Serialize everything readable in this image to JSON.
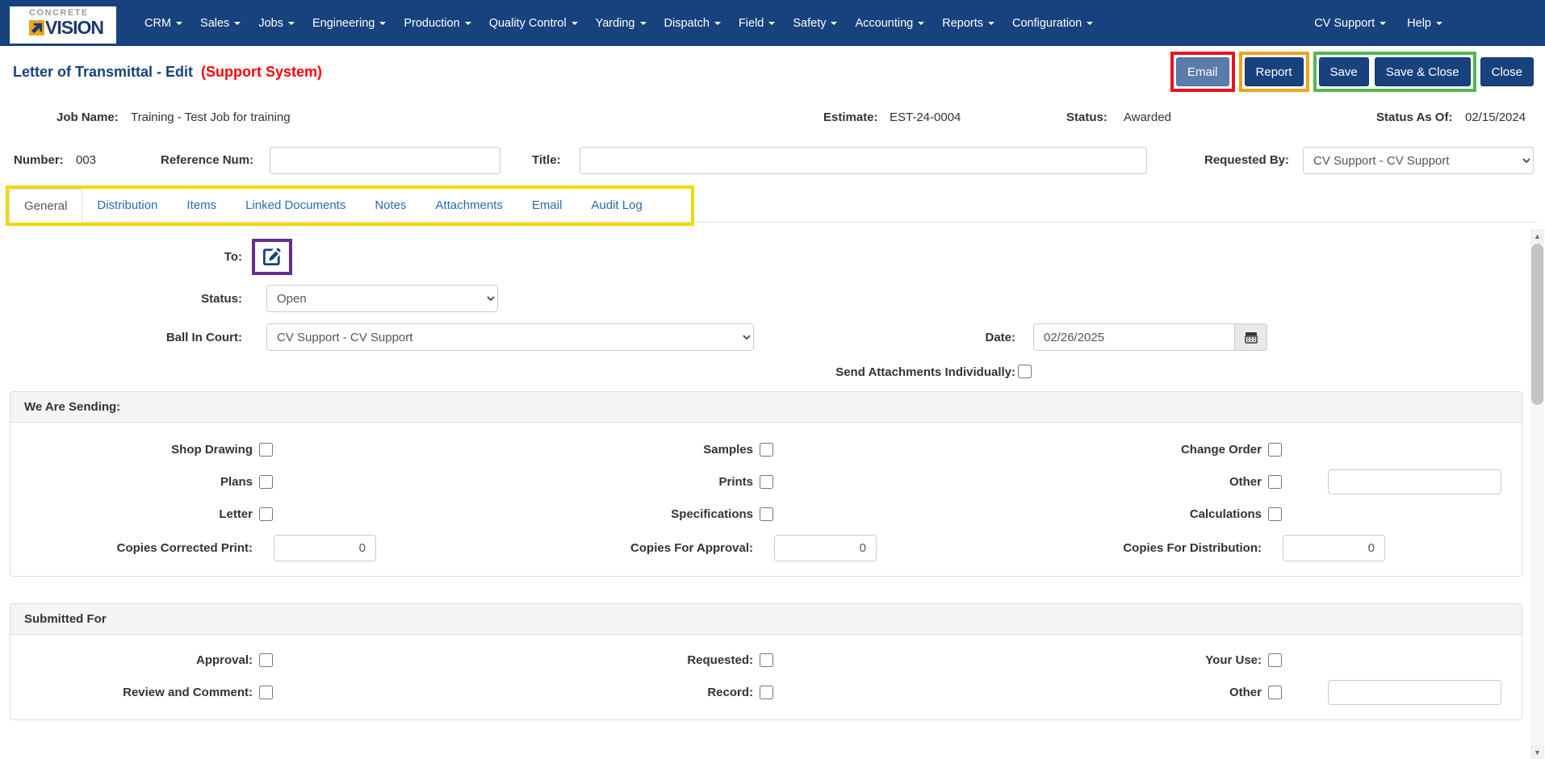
{
  "colors": {
    "navy": "#17427d",
    "title_red": "#ff0000",
    "annotation_red": "#e8151e",
    "annotation_orange": "#f0a31c",
    "annotation_green": "#53b94e",
    "annotation_yellow": "#f2d900",
    "annotation_purple": "#662d91",
    "tab_link_blue": "#2a6cab",
    "email_button_blue": "#5b7ca9"
  },
  "nav": {
    "logo_top": "CONCRETE",
    "logo_bottom": "VISION",
    "items": [
      "CRM",
      "Sales",
      "Jobs",
      "Engineering",
      "Production",
      "Quality Control",
      "Yarding",
      "Dispatch",
      "Field",
      "Safety",
      "Accounting",
      "Reports",
      "Configuration"
    ],
    "user_menu": "CV Support",
    "help_menu": "Help"
  },
  "header": {
    "title": "Letter of Transmittal - Edit",
    "subtitle": "(Support System)",
    "buttons": {
      "email": "Email",
      "report": "Report",
      "save": "Save",
      "save_and_close": "Save & Close",
      "close": "Close"
    }
  },
  "job": {
    "job_name_label": "Job Name:",
    "job_name": "Training - Test Job for training",
    "estimate_label": "Estimate:",
    "estimate": "EST-24-0004",
    "status_label": "Status:",
    "status": "Awarded",
    "status_as_of_label": "Status As Of:",
    "status_as_of": "02/15/2024"
  },
  "fields": {
    "number_label": "Number:",
    "number_value": "003",
    "reference_label": "Reference Num:",
    "reference_value": "",
    "title_label": "Title:",
    "title_value": "",
    "requested_by_label": "Requested By:",
    "requested_by_value": "CV Support - CV Support"
  },
  "tabs": {
    "active": "General",
    "items": [
      "General",
      "Distribution",
      "Items",
      "Linked Documents",
      "Notes",
      "Attachments",
      "Email",
      "Audit Log"
    ]
  },
  "general_tab": {
    "to_label": "To:",
    "status_label": "Status:",
    "status_value": "Open",
    "ball_in_court_label": "Ball In Court:",
    "ball_in_court_value": "CV Support - CV Support",
    "date_label": "Date:",
    "date_value": "02/26/2025",
    "send_attachments_label": "Send Attachments Individually:"
  },
  "we_are_sending": {
    "header": "We Are Sending:",
    "row1": [
      "Shop Drawing",
      "Samples",
      "Change Order"
    ],
    "row2": [
      "Plans",
      "Prints",
      "Other"
    ],
    "other_value": "",
    "row3": [
      "Letter",
      "Specifications",
      "Calculations"
    ],
    "copies_labels": [
      "Copies Corrected Print:",
      "Copies For Approval:",
      "Copies For Distribution:"
    ],
    "copies_values": [
      "0",
      "0",
      "0"
    ]
  },
  "submitted_for": {
    "header": "Submitted For",
    "row1": [
      "Approval:",
      "Requested:",
      "Your Use:"
    ],
    "row2": [
      "Review and Comment:",
      "Record:",
      "Other"
    ],
    "other_value": ""
  },
  "icons": {
    "scroll_up": "▲",
    "scroll_down": "▼"
  }
}
